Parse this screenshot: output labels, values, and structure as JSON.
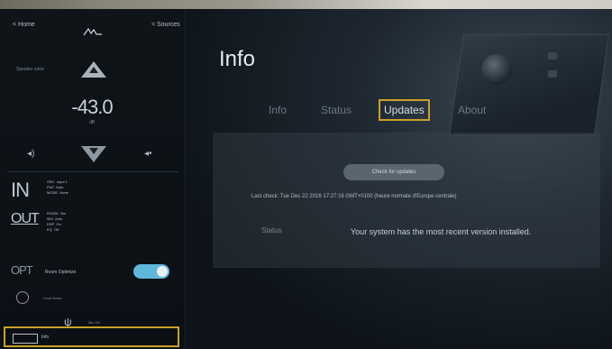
{
  "sidebar": {
    "left_link": "< Home",
    "right_link": "< Sources",
    "zone_label": "Speaker zone",
    "volume": "-43.0",
    "volume_unit": "dB",
    "input_label": "IN",
    "input_lines": "SRC  Input 1\nFMT  Auto\nMODE  None",
    "output_label": "OUT",
    "output_lines": "ROOM  Yes\nMIX  Auto\nDSP  On\nEQ  Off",
    "options_label": "OPT",
    "options_item": "Room Optimize",
    "dial_label": "Level  None",
    "fork_label": "Mic  On",
    "bottom_label": "Info"
  },
  "main": {
    "title": "Info",
    "tabs": [
      {
        "label": "Info"
      },
      {
        "label": "Status"
      },
      {
        "label": "Updates"
      },
      {
        "label": "About"
      }
    ],
    "active_tab": "Updates",
    "check_button": "Check for updates",
    "last_check": "Last check: Tue Dec 22 2016 17:27:16 GMT+0100 (heure normale d'Europe centrale)",
    "status_label": "Status",
    "status_value": "Your system has the most recent version installed."
  },
  "colors": {
    "accent": "#c9a227",
    "toggle": "#5fb7dc",
    "background": "#0d1218"
  }
}
